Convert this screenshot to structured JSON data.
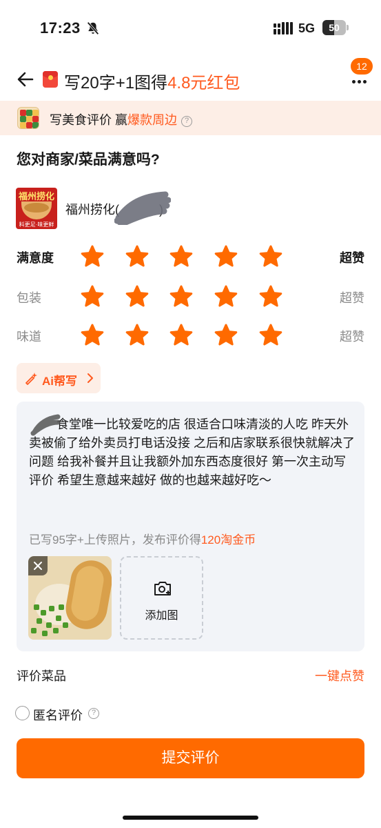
{
  "status_bar": {
    "time": "17:23",
    "network": "5G",
    "battery": "50",
    "battery_level": 0.5
  },
  "header": {
    "title_prefix": "写20字+1图得",
    "title_amount": "4.8元红包",
    "more_badge": "12"
  },
  "banner": {
    "text": "写美食评价 赢",
    "highlight": "爆款周边",
    "help_icon": "?"
  },
  "question": "您对商家/菜品满意吗?",
  "shop": {
    "name": "福州捞化(",
    "name_suffix": ")",
    "logo_top": "福州捞化",
    "logo_bottom": "料更足·味更鲜"
  },
  "ratings": [
    {
      "label": "满意度",
      "stars": 5,
      "value": "超赞",
      "primary": true
    },
    {
      "label": "包装",
      "stars": 5,
      "value": "超赞",
      "primary": false
    },
    {
      "label": "味道",
      "stars": 5,
      "value": "超赞",
      "primary": false
    }
  ],
  "colors": {
    "accent": "#ff6a00",
    "star": "#ff6a00",
    "highlight_text": "#ff5a1f"
  },
  "ai_button": {
    "label": "Ai帮写"
  },
  "review": {
    "text": "食堂唯一比较爱吃的店 很适合口味清淡的人吃 昨天外卖被偷了给外卖员打电话没接 之后和店家联系很快就解决了问题 给我补餐并且让我额外加东西态度很好  第一次主动写评价 希望生意越来越好 做的也越来越好吃～",
    "hint_prefix": "已写95字+上传照片，发布评价得",
    "hint_reward": "120淘金币",
    "add_photo_label": "添加图"
  },
  "dish": {
    "label": "评价菜品",
    "action": "一键点赞"
  },
  "anonymous": {
    "label": "匿名评价",
    "help_icon": "?"
  },
  "submit": {
    "label": "提交评价"
  }
}
